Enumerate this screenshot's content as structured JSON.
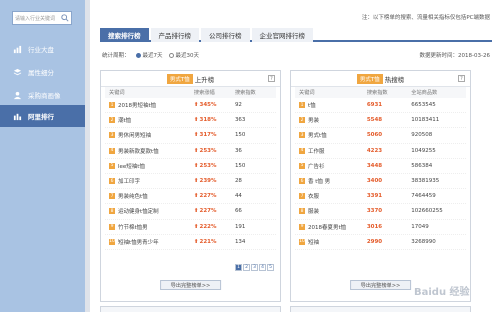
{
  "sidebar": {
    "search_placeholder": "请输入行业关键词",
    "items": [
      {
        "label": "行业大盘",
        "icon": "chart-icon"
      },
      {
        "label": "属性细分",
        "icon": "layers-icon"
      },
      {
        "label": "采购商画像",
        "icon": "user-icon"
      },
      {
        "label": "阿里排行",
        "icon": "bar-chart-icon"
      }
    ]
  },
  "notice": "注：以下榜单的搜索、流量相关指标仅包括PC端数据",
  "tabs": [
    "搜索排行榜",
    "产品排行榜",
    "公司排行榜",
    "企业官网排行榜"
  ],
  "filter": {
    "label": "统计周期：",
    "opt1": "最近7天",
    "opt2": "最近30天"
  },
  "update": "数据更新时间：2018-03-26",
  "left_panel": {
    "badge": "男式T恤",
    "title": "上升榜",
    "headers": [
      "关键词",
      "搜索涨幅",
      "搜索指数"
    ],
    "rows": [
      {
        "rank": "1",
        "kw": "2018男短袖t恤",
        "rate": "345%",
        "idx": "92"
      },
      {
        "rank": "2",
        "kw": "潮t恤",
        "rate": "318%",
        "idx": "363"
      },
      {
        "rank": "3",
        "kw": "男休闲男短袖",
        "rate": "317%",
        "idx": "150"
      },
      {
        "rank": "4",
        "kw": "男装新款夏款t恤",
        "rate": "253%",
        "idx": "36"
      },
      {
        "rank": "5",
        "kw": "lee短袖t恤",
        "rate": "253%",
        "idx": "150"
      },
      {
        "rank": "6",
        "kw": "加工印字",
        "rate": "239%",
        "idx": "28"
      },
      {
        "rank": "7",
        "kw": "男装纯色t恤",
        "rate": "227%",
        "idx": "44"
      },
      {
        "rank": "8",
        "kw": "运动健身t恤定制",
        "rate": "227%",
        "idx": "66"
      },
      {
        "rank": "9",
        "kw": "竹节棉t恤男",
        "rate": "222%",
        "idx": "191"
      },
      {
        "rank": "10",
        "kw": "短袖t恤男青少年",
        "rate": "221%",
        "idx": "134"
      }
    ],
    "pages": [
      "1",
      "2",
      "3",
      "4",
      "5"
    ],
    "export": "导出完整榜单>>"
  },
  "right_panel": {
    "badge": "男式T恤",
    "title": "热搜榜",
    "headers": [
      "关键词",
      "搜索指数",
      "全站商品数"
    ],
    "rows": [
      {
        "rank": "1",
        "kw": "t恤",
        "idx": "6931",
        "cnt": "6653545"
      },
      {
        "rank": "2",
        "kw": "男装",
        "idx": "5548",
        "cnt": "10183411"
      },
      {
        "rank": "3",
        "kw": "男式t恤",
        "idx": "5060",
        "cnt": "920508"
      },
      {
        "rank": "4",
        "kw": "工作服",
        "idx": "4223",
        "cnt": "1049255"
      },
      {
        "rank": "5",
        "kw": "广告衫",
        "idx": "3448",
        "cnt": "586384"
      },
      {
        "rank": "6",
        "kw": "香 t恤 男",
        "idx": "3400",
        "cnt": "38381935"
      },
      {
        "rank": "7",
        "kw": "衣服",
        "idx": "3391",
        "cnt": "7464459"
      },
      {
        "rank": "8",
        "kw": "服装",
        "idx": "3370",
        "cnt": "102660255"
      },
      {
        "rank": "9",
        "kw": "2018春夏男t恤",
        "idx": "3016",
        "cnt": "17049"
      },
      {
        "rank": "10",
        "kw": "短袖",
        "idx": "2990",
        "cnt": "3268990"
      }
    ],
    "export": "导出完整榜单>>"
  },
  "watermark": "Baidu 经验"
}
